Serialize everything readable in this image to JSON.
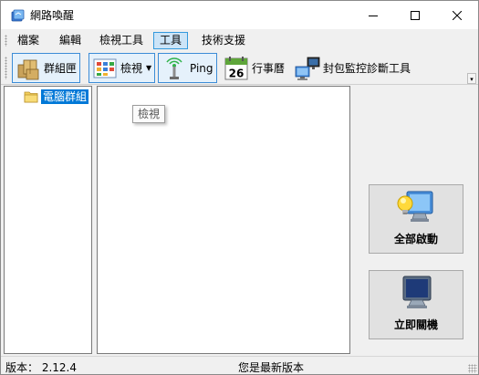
{
  "window": {
    "title": "網路喚醒",
    "icons": {
      "app": "app-icon",
      "minimize": "minimize-icon",
      "maximize": "maximize-icon",
      "close": "close-icon"
    }
  },
  "menu": {
    "items": [
      {
        "label": "檔案",
        "active": false
      },
      {
        "label": "編輯",
        "active": false
      },
      {
        "label": "檢視工具",
        "active": false
      },
      {
        "label": "工具",
        "active": true
      },
      {
        "label": "技術支援",
        "active": false
      }
    ]
  },
  "toolbar": {
    "buttons": [
      {
        "label": "群組匣",
        "icon": "boxes-icon",
        "boxed": true
      },
      {
        "label": "檢視",
        "icon": "view-grid-icon",
        "boxed": true,
        "dropdown": true
      },
      {
        "label": "Ping",
        "icon": "antenna-icon",
        "boxed": true
      },
      {
        "label": "行事曆",
        "icon": "calendar-icon",
        "boxed": false,
        "calendar_day": "26"
      },
      {
        "label": "封包監控診斷工具",
        "icon": "network-monitor-icon",
        "boxed": false
      }
    ],
    "overflow_glyph": "▾"
  },
  "tree": {
    "root_label": "電腦群組",
    "icon": "folder-icon"
  },
  "list": {
    "tooltip": "檢視"
  },
  "actions": {
    "wake_all": {
      "label": "全部啟動",
      "icon": "computer-bulb-icon"
    },
    "shutdown": {
      "label": "立即關機",
      "icon": "computer-icon"
    }
  },
  "status": {
    "version_text": "版本：  2.12.4",
    "update_text": "您是最新版本"
  },
  "colors": {
    "selection": "#0078d7",
    "menu_active_bg": "#cce4f7",
    "menu_active_border": "#3399dd",
    "window_bg": "#f0f0f0"
  }
}
